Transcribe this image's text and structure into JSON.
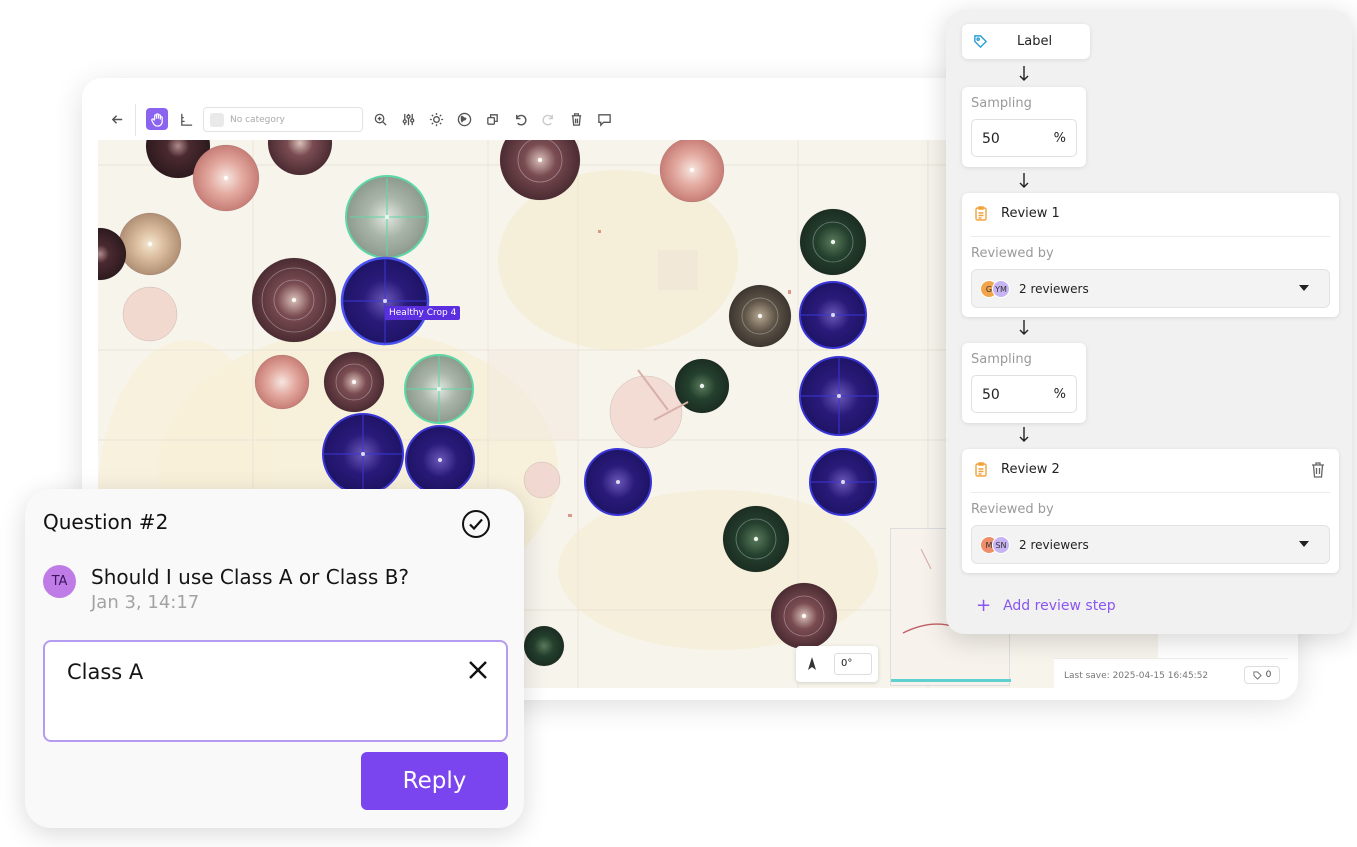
{
  "editor": {
    "toolbar": {
      "category_placeholder": "No category",
      "icons": [
        "back-arrow-icon",
        "hand-pan-icon",
        "corner-ruler-icon",
        "zoom-icon",
        "adjustments-icon",
        "brightness-icon",
        "globe-icon",
        "copy-icon",
        "undo-icon",
        "redo-icon",
        "trash-icon",
        "comment-icon"
      ]
    },
    "canvas": {
      "annotation_label": "Healthy Crop 4",
      "rotation_value": "0°"
    },
    "status": {
      "last_save": "Last save: 2025-04-15 16:45:52",
      "tag_count": "0"
    }
  },
  "workflow": {
    "label_step": "Label",
    "sampling_1": {
      "title": "Sampling",
      "value": "50",
      "unit": "%"
    },
    "review_1": {
      "title": "Review 1",
      "reviewed_by_label": "Reviewed by",
      "reviewers_count": "2 reviewers",
      "avatars": [
        {
          "initials": "G",
          "color": "#f2a44a"
        },
        {
          "initials": "YM",
          "color": "#c7b4f2"
        }
      ]
    },
    "sampling_2": {
      "title": "Sampling",
      "value": "50",
      "unit": "%"
    },
    "review_2": {
      "title": "Review 2",
      "reviewed_by_label": "Reviewed by",
      "reviewers_count": "2 reviewers",
      "avatars": [
        {
          "initials": "M",
          "color": "#ef8e6a"
        },
        {
          "initials": "SN",
          "color": "#c7b4f2"
        }
      ]
    },
    "add_step_label": "Add review step",
    "accent_color": "#8a55f0"
  },
  "question": {
    "title": "Question #2",
    "author_initials": "TA",
    "message": "Should I use Class A or Class B?",
    "timestamp": "Jan 3, 14:17",
    "reply_value": "Class A",
    "reply_button": "Reply",
    "reply_button_color": "#7a45ee"
  }
}
